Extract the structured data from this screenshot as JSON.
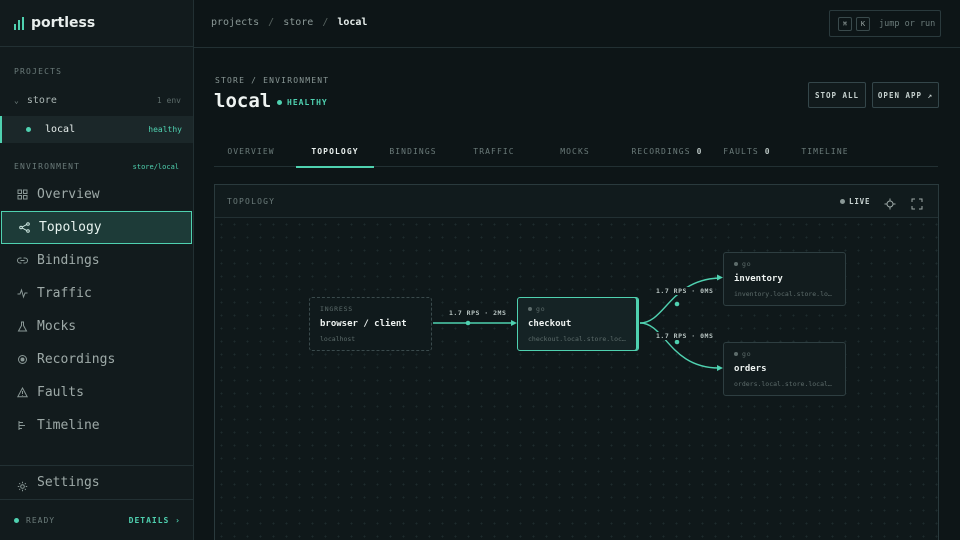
{
  "app": {
    "name": "portless"
  },
  "sidebar": {
    "projects_label": "PROJECTS",
    "project": {
      "name": "store",
      "count": "1 env"
    },
    "env": {
      "name": "local",
      "status": "healthy"
    },
    "environment_label": "ENVIRONMENT",
    "environment_path": "store/local",
    "items": [
      {
        "label": "Overview",
        "icon": "grid-icon"
      },
      {
        "label": "Topology",
        "icon": "topology-icon"
      },
      {
        "label": "Bindings",
        "icon": "link-icon"
      },
      {
        "label": "Traffic",
        "icon": "pulse-icon"
      },
      {
        "label": "Mocks",
        "icon": "flask-icon"
      },
      {
        "label": "Recordings",
        "icon": "record-icon"
      },
      {
        "label": "Faults",
        "icon": "warning-icon"
      },
      {
        "label": "Timeline",
        "icon": "timeline-icon"
      }
    ],
    "active_index": 1,
    "settings": {
      "label": "Settings",
      "icon": "gear-icon"
    },
    "status": {
      "label": "READY",
      "details": "DETAILS ›"
    }
  },
  "topbar": {
    "breadcrumb": [
      "projects",
      "store",
      "local"
    ],
    "cmd": {
      "key1": "⌘",
      "key2": "K",
      "hint": "jump or run"
    }
  },
  "header": {
    "crumb": "STORE / ENVIRONMENT",
    "title": "local",
    "health": "HEALTHY",
    "stop_all": "STOP ALL",
    "open_app": "OPEN APP ↗"
  },
  "tabs": [
    {
      "label": "OVERVIEW",
      "count": ""
    },
    {
      "label": "TOPOLOGY",
      "count": ""
    },
    {
      "label": "BINDINGS",
      "count": ""
    },
    {
      "label": "TRAFFIC",
      "count": ""
    },
    {
      "label": "MOCKS",
      "count": ""
    },
    {
      "label": "RECORDINGS",
      "count": "0"
    },
    {
      "label": "FAULTS",
      "count": "0"
    },
    {
      "label": "TIMELINE",
      "count": ""
    }
  ],
  "active_tab": 1,
  "topology": {
    "title": "TOPOLOGY",
    "live": "LIVE",
    "nodes": {
      "ingress": {
        "kind": "INGRESS",
        "title": "browser / client",
        "host": "localhost"
      },
      "checkout": {
        "kind": "go",
        "title": "checkout",
        "host": "checkout.local.store.localh…"
      },
      "inventory": {
        "kind": "go",
        "title": "inventory",
        "host": "inventory.local.store.local…"
      },
      "orders": {
        "kind": "go",
        "title": "orders",
        "host": "orders.local.store.localhost"
      }
    },
    "edges": {
      "ingress_checkout": "1.7 RPS · 2MS",
      "checkout_inventory": "1.7 RPS · 0MS",
      "checkout_orders": "1.7 RPS · 0MS"
    }
  },
  "colors": {
    "accent": "#4fd1b0",
    "background": "#0d1517",
    "sidebar": "#121b1d"
  }
}
